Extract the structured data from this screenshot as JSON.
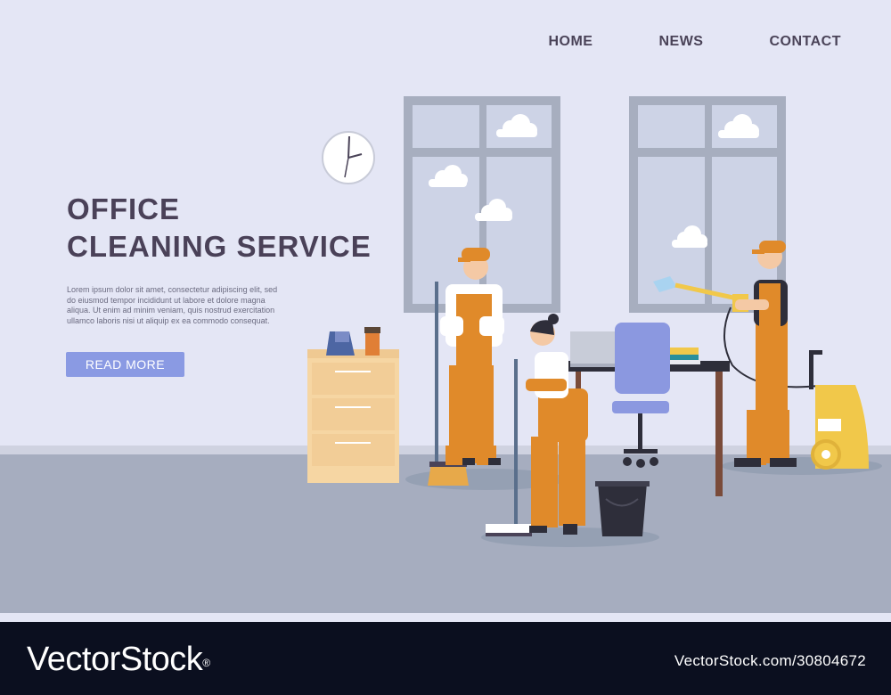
{
  "nav": {
    "home": "HOME",
    "news": "NEWS",
    "contact": "CONTACT"
  },
  "hero": {
    "title_line1": "OFFICE",
    "title_line2": "CLEANING SERVICE",
    "body_line1": "Lorem ipsum dolor sit amet, consectetur adipiscing elit, sed",
    "body_line2": "do eiusmod tempor incididunt ut labore et dolore magna",
    "body_line3": "aliqua. Ut enim ad minim veniam, quis nostrud exercitation",
    "body_line4": "ullamco laboris nisi ut aliquip ex ea commodo consequat.",
    "button_label": "READ MORE"
  },
  "footer": {
    "logo": "VectorStock",
    "trademark": "®",
    "image_id": "VectorStock.com/30804672"
  },
  "colors": {
    "wall": "#e4e6f5",
    "floor": "#a6adbf",
    "accent_button": "#8a9ae3",
    "uniform_orange": "#e08a2a",
    "heading": "#4a4158",
    "footer_bg": "#0b0f1f"
  },
  "icons": {
    "clock": "wall-clock-icon",
    "cloud": "cloud-icon"
  }
}
